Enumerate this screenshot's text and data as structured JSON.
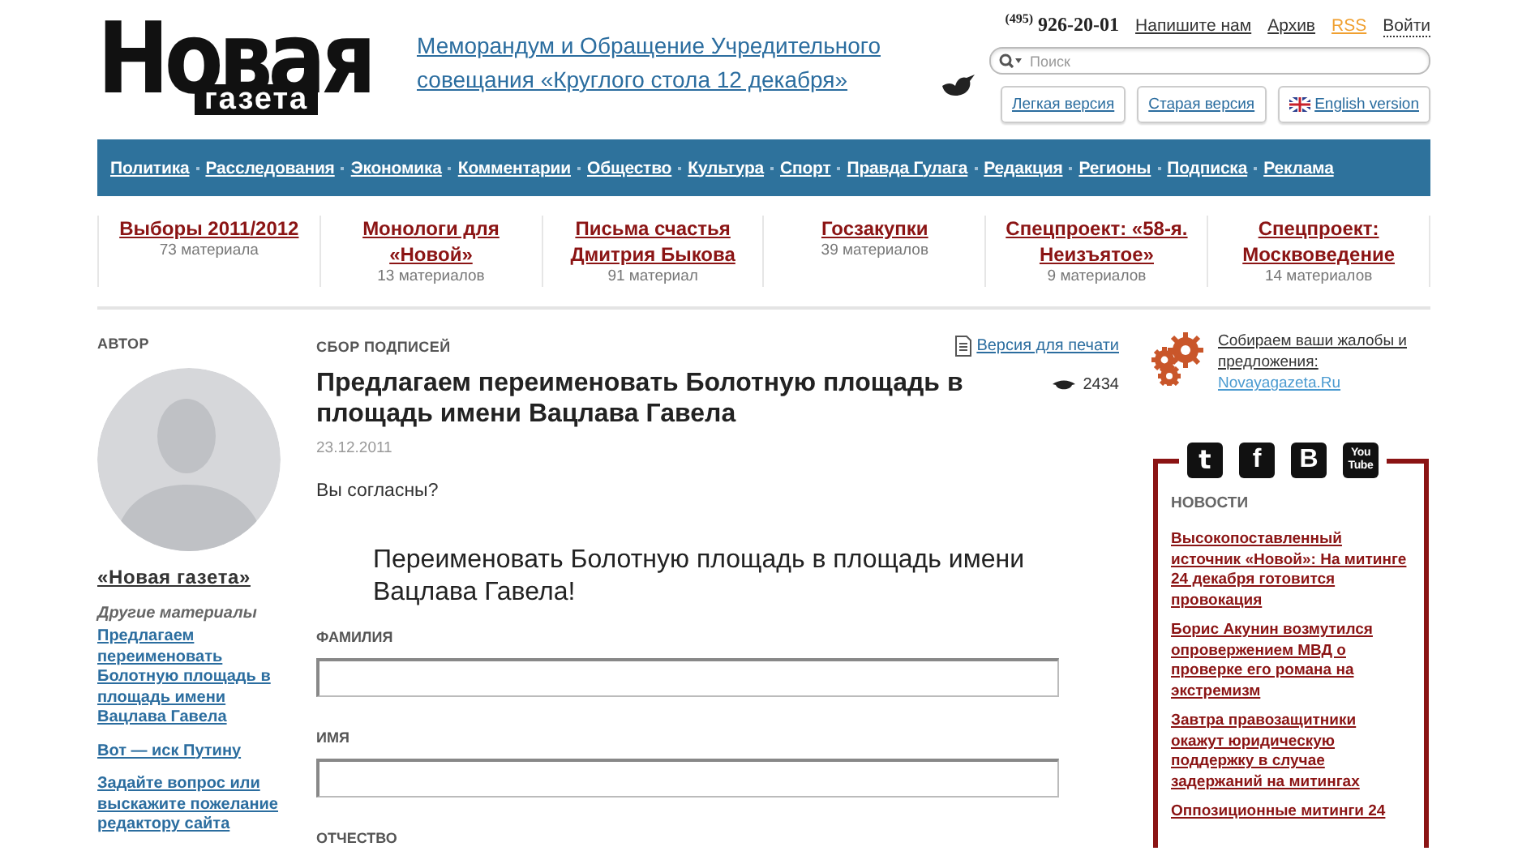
{
  "logo": {
    "line1": "Новая",
    "line2": "газета"
  },
  "promo": {
    "text": "Меморандум и Обращение Учредительного совещания «Круглого стола 12 декабря»"
  },
  "contacts": {
    "phone_code": "(495)",
    "phone": "926-20-01",
    "links": [
      {
        "label": "Напишите нам",
        "kind": "link"
      },
      {
        "label": "Архив",
        "kind": "link"
      },
      {
        "label": "RSS",
        "kind": "rss"
      },
      {
        "label": "Войти",
        "kind": "login"
      }
    ]
  },
  "search": {
    "placeholder": "Поиск"
  },
  "versions": [
    {
      "label": "Легкая версия",
      "kind": "plain"
    },
    {
      "label": "Старая версия",
      "kind": "plain"
    },
    {
      "label": "English version",
      "kind": "flag"
    }
  ],
  "nav": [
    "Политика",
    "Расследования",
    "Экономика",
    "Комментарии",
    "Общество",
    "Культура",
    "Спорт",
    "Правда Гулага",
    "Редакция",
    "Регионы",
    "Подписка",
    "Реклама"
  ],
  "rubrics": [
    {
      "title": "Выборы 2011/2012",
      "count": "73 материала"
    },
    {
      "title": "Монологи для «Новой»",
      "count": "13 материалов"
    },
    {
      "title": "Письма счастья Дмитрия Быкова",
      "count": "91 материал"
    },
    {
      "title": "Госзакупки",
      "count": "39 материалов"
    },
    {
      "title": "Спецпроект: «58-я. Неизъятое»",
      "count": "9 материалов"
    },
    {
      "title": "Спецпроект: Москвоведение",
      "count": "14 материалов"
    }
  ],
  "author": {
    "heading": "АВТОР",
    "name": "«Новая газета»",
    "others_heading": "Другие материалы",
    "others": [
      "Предлагаем переименовать Болотную площадь в площадь имени Вацлава Гавела",
      "Вот — иск Путину",
      "Задайте вопрос или выскажите пожелание редактору сайта"
    ]
  },
  "article": {
    "rubric": "СБОР ПОДПИСЕЙ",
    "print": "Версия для печати",
    "title": "Предлагаем переименовать Болотную площадь в площадь имени Вацлава Гавела",
    "views": "2434",
    "date": "23.12.2011",
    "lead": "Вы согласны?",
    "petition": "Переименовать Болотную площадь в площадь имени Вацлава Гавела!",
    "fields": [
      {
        "label": "ФАМИЛИЯ",
        "kind": "input"
      },
      {
        "label": "ИМЯ",
        "kind": "input"
      },
      {
        "label": "ОТЧЕСТВО",
        "kind": "label"
      }
    ]
  },
  "feedback": {
    "text": "Собираем ваши жалобы и предложения:",
    "link": "Novayagazeta.Ru"
  },
  "social": [
    {
      "kind": "twitter",
      "label": "t"
    },
    {
      "kind": "facebook",
      "label": "f"
    },
    {
      "kind": "vk",
      "label": "B"
    },
    {
      "kind": "youtube",
      "label": "You Tube"
    }
  ],
  "news": {
    "heading": "НОВОСТИ",
    "items": [
      "Высокопоставленный источник «Новой»: На митинге 24 декабря готовится провокация",
      "Борис Акунин возмутился опровержением МВД о проверке его романа на экстремизм",
      "Завтра правозащитники окажут юридическую поддержку в случае задержаний на митингах",
      "Оппозиционные митинги 24"
    ]
  }
}
